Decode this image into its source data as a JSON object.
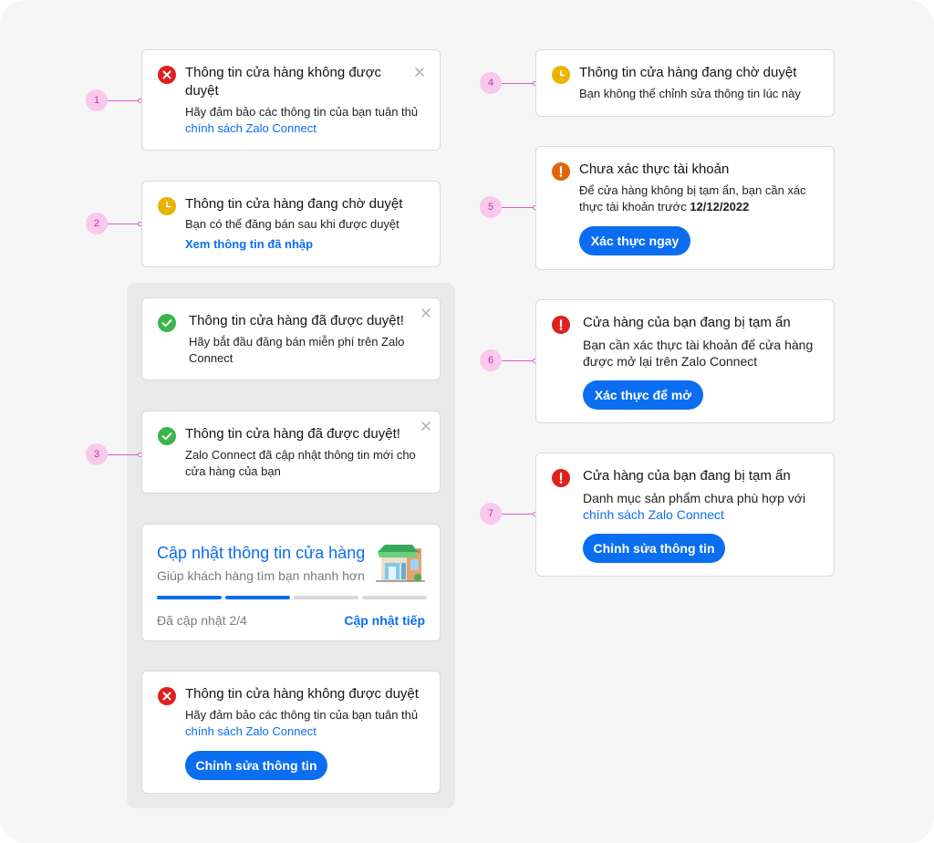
{
  "colors": {
    "primary": "#0b6df0",
    "error": "#e02020",
    "pending": "#e8b400",
    "warning": "#e0650a",
    "success": "#3bb54a",
    "marker_bg": "#f8c9ec",
    "marker_text": "#c0359a"
  },
  "markers": [
    "1",
    "2",
    "3",
    "4",
    "5",
    "6",
    "7"
  ],
  "card1": {
    "icon": "error-x-icon",
    "title": "Thông tin cửa hàng không được duyệt",
    "desc_prefix": "Hãy đảm bảo các thông tin của bạn tuân thủ ",
    "link": "chính sách Zalo Connect"
  },
  "card2": {
    "icon": "clock-icon",
    "title": "Thông tin cửa hàng đang chờ duyệt",
    "desc": "Bạn có thể đăng bán sau khi được duyệt",
    "link": "Xem thông tin đã nhập"
  },
  "card3a": {
    "icon": "check-icon",
    "title": "Thông tin cửa hàng đã được duyệt!",
    "desc": "Hãy bắt đầu đăng bán miễn phí trên Zalo Connect"
  },
  "card3b": {
    "icon": "check-icon",
    "title": "Thông tin cửa hàng đã được duyệt!",
    "desc": "Zalo Connect đã cập nhật thông tin mới cho cửa hàng của bạn"
  },
  "card3c": {
    "title": "Cập nhật thông tin cửa hàng",
    "subtitle": "Giúp khách hàng tìm bạn nhanh hơn",
    "progress_label": "Đã cập nhật 2/4",
    "progress_done": 2,
    "progress_total": 4,
    "link": "Cập nhật tiếp",
    "illustration": "storefront-illustration"
  },
  "card3d": {
    "icon": "error-x-icon",
    "title": "Thông tin cửa hàng không được duyệt",
    "desc_prefix": "Hãy đảm bảo các thông tin của bạn tuân thủ ",
    "link": "chính sách Zalo Connect",
    "button": "Chỉnh sửa thông tin"
  },
  "card4": {
    "icon": "clock-icon",
    "title": "Thông tin cửa hàng đang chờ duyệt",
    "desc": "Bạn không thể chỉnh sửa thông tin lúc này"
  },
  "card5": {
    "icon": "warning-exclamation-icon",
    "title": "Chưa xác thực tài khoản",
    "desc_prefix": "Để cửa hàng không bị tạm ẩn, bạn cần xác thực tài khoản trước ",
    "desc_date": "12/12/2022",
    "button": "Xác thực ngay"
  },
  "card6": {
    "icon": "error-exclamation-icon",
    "title": "Cửa hàng của bạn đang bị tạm ẩn",
    "desc": "Bạn cần xác thực tài khoản để cửa hàng được mở lại trên Zalo Connect",
    "button": "Xác thực để mở"
  },
  "card7": {
    "icon": "error-exclamation-icon",
    "title": "Cửa hàng của bạn đang bị tạm ẩn",
    "desc_prefix": "Danh mục sản phẩm chưa phù hợp với",
    "link": "chính sách Zalo Connect",
    "button": "Chỉnh sửa thông tin"
  }
}
